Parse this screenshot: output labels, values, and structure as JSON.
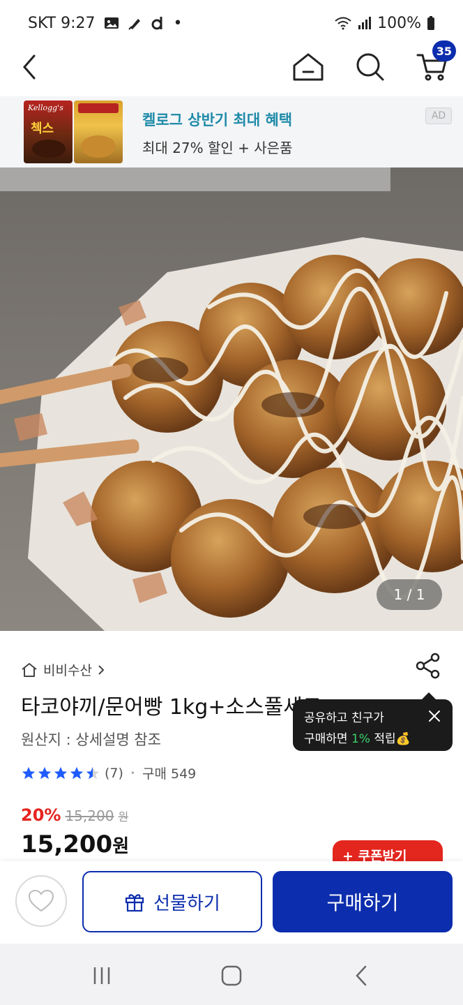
{
  "status_bar": {
    "carrier_time": "SKT 9:27",
    "extra": "•",
    "battery": "100%"
  },
  "nav": {
    "cart_count": "35"
  },
  "ad": {
    "title": "켈로그 상반기 최대 혜택",
    "subtitle": "최대 27% 할인 + 사은품",
    "badge": "AD",
    "brand": "Kellogg's",
    "product_text": "첵스"
  },
  "image": {
    "counter": "1 / 1"
  },
  "product": {
    "seller": "비비수산",
    "title": "타코야끼/문어빵 1kg+소스풀세트",
    "origin": "원산지 : 상세설명 참조",
    "rating": 4.5,
    "review_count": "(7)",
    "purchase_count": "구매 549",
    "discount": "20%",
    "original_price": "15,200",
    "original_unit": "원",
    "final_price": "15,200",
    "final_unit": "원",
    "coupon_label": "+ 쿠폰받기"
  },
  "tooltip": {
    "line1": "공유하고 친구가",
    "line2_prefix": "구매하면 ",
    "line2_highlight": "1%",
    "line2_suffix": " 적립",
    "emoji": "💰"
  },
  "actions": {
    "gift_label": "선물하기",
    "buy_label": "구매하기"
  },
  "colors": {
    "brand_blue": "#0c2dad",
    "discount_red": "#e5241e",
    "ad_teal": "#1e8aa8",
    "highlight_green": "#3bd26b"
  }
}
